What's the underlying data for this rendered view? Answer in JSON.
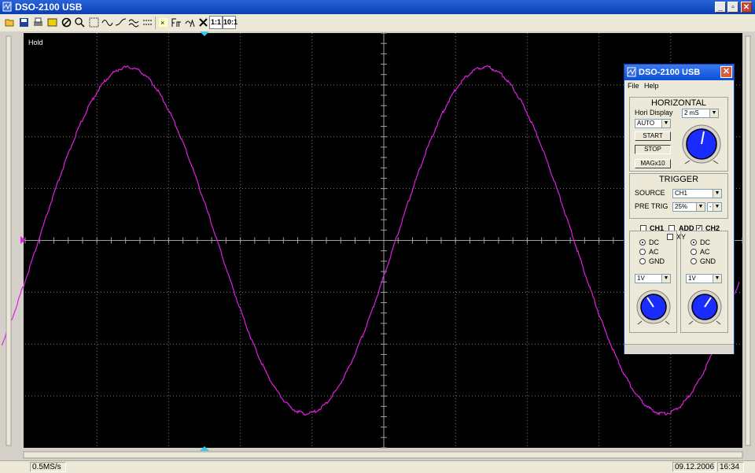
{
  "window": {
    "title": "DSO-2100 USB"
  },
  "toolbar": {
    "ratio_1": "1:1",
    "ratio_10": "10:1"
  },
  "scope": {
    "hold_label": "Hold",
    "trace_color": "#e020e0",
    "grid_color": "#7a7a7a",
    "background": "#000000"
  },
  "statusbar": {
    "sample_rate": "0.5MS/s",
    "date": "09.12.2006",
    "time": "16:34"
  },
  "panel": {
    "title": "DSO-2100 USB",
    "menu": {
      "file": "File",
      "help": "Help"
    },
    "horizontal": {
      "title": "HORIZONTAL",
      "hori_display_label": "Hori Display",
      "timebase": "2 mS",
      "mode": "AUTO",
      "start": "START",
      "stop": "STOP",
      "mag": "MAGx10"
    },
    "trigger": {
      "title": "TRIGGER",
      "source_label": "SOURCE",
      "source": "CH1",
      "pretrig_label": "PRE TRIG",
      "pretrig": "25%",
      "slope": "-"
    },
    "channels": {
      "ch1": {
        "label": "CH1",
        "dc": "DC",
        "ac": "AC",
        "gnd": "GND",
        "volts": "1V"
      },
      "add": "ADD",
      "xy": "XY",
      "ch2": {
        "label": "CH2",
        "dc": "DC",
        "ac": "AC",
        "gnd": "GND",
        "volts": "1V"
      }
    },
    "knob_color": "#1a2cff"
  }
}
